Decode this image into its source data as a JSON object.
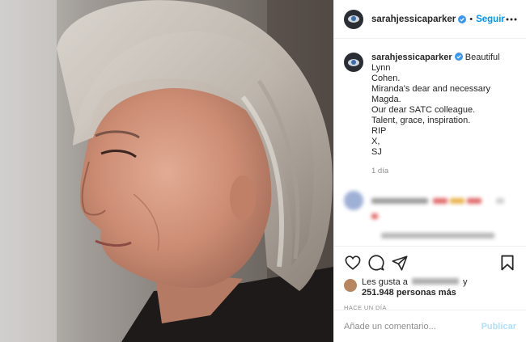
{
  "post": {
    "author": {
      "username": "sarahjessicaparker",
      "verified": true,
      "verified_icon": "verified-badge-icon",
      "avatar_icon": "avatar-eye-image"
    },
    "header": {
      "separator": "•",
      "follow_label": "Seguir",
      "more_icon": "ellipsis-icon"
    },
    "caption": {
      "first_line": "Beautiful Lynn",
      "lines": [
        "Cohen.",
        "Miranda's dear and necessary",
        "Magda.",
        "Our dear SATC colleague.",
        "Talent, grace, inspiration.",
        "RIP",
        "X,",
        "SJ"
      ],
      "time": "1 día"
    },
    "actions": {
      "like_icon": "heart-icon",
      "comment_icon": "comment-bubble-icon",
      "share_icon": "paper-plane-icon",
      "save_icon": "bookmark-icon"
    },
    "likes": {
      "prefix": "Les gusta a",
      "connector": "y",
      "count": "251.948 personas más"
    },
    "timestamp": "Hace un día",
    "comment_box": {
      "placeholder": "Añade un comentario...",
      "publish_label": "Publicar"
    },
    "colors": {
      "link_blue": "#0095f6",
      "publish_disabled": "#b2dffc",
      "muted_gray": "#8e8e8e",
      "text": "#262626",
      "divider": "#efefef"
    }
  }
}
